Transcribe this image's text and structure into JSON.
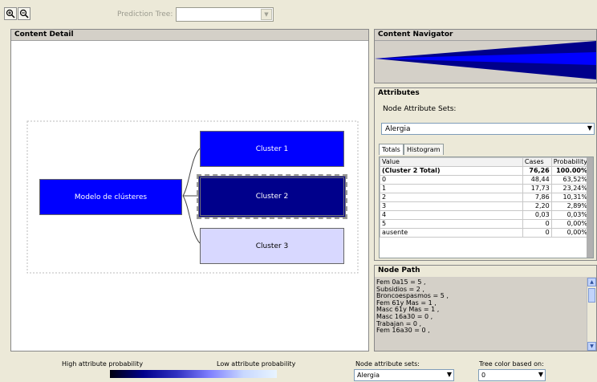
{
  "toolbar": {
    "prediction_tree_label": "Prediction Tree:",
    "prediction_tree_value": "",
    "icons": [
      "zoom-in-icon",
      "zoom-out-icon"
    ]
  },
  "content_detail": {
    "title": "Content Detail",
    "nodes": {
      "root": "Modelo de clústeres",
      "cluster1": "Cluster 1",
      "cluster2": "Cluster 2",
      "cluster3": "Cluster 3"
    },
    "colors": {
      "root": "#0000ff",
      "cluster1": "#0000ff",
      "cluster2": "#00008b",
      "cluster3": "#d8d8ff"
    }
  },
  "navigator": {
    "title": "Content Navigator"
  },
  "attributes": {
    "title": "Attributes",
    "sets_label": "Node Attribute Sets:",
    "selected_set": "Alergia",
    "tabs": [
      "Totals",
      "Histogram"
    ],
    "columns": [
      "Value",
      "Cases",
      "Probability"
    ],
    "rows": [
      [
        "(Cluster 2 Total)",
        "76,26",
        "100.00%"
      ],
      [
        "0",
        "48,44",
        "63,52%"
      ],
      [
        "1",
        "17,73",
        "23,24%"
      ],
      [
        "2",
        "7,86",
        "10,31%"
      ],
      [
        "3",
        "2,20",
        "2,89%"
      ],
      [
        "4",
        "0,03",
        "0,03%"
      ],
      [
        "5",
        "0",
        "0,00%"
      ],
      [
        "ausente",
        "0",
        "0,00%"
      ]
    ]
  },
  "node_path": {
    "title": "Node Path",
    "lines": [
      "Fem 0a15 = 5 ,",
      "Subsidios = 2 ,",
      "Broncoespasmos = 5 ,",
      "Fem 61y Mas = 1 ,",
      "Masc 61y Mas = 1 ,",
      "Masc 16a30 = 0 ,",
      "Trabajan = 0 ,",
      "Fem 16a30 = 0 ,"
    ]
  },
  "bottom": {
    "high_label": "High attribute probability",
    "low_label": "Low attribute probability",
    "node_sets_label": "Node attribute sets:",
    "node_sets_value": "Alergia",
    "tree_color_label": "Tree color based on:",
    "tree_color_value": "0"
  }
}
